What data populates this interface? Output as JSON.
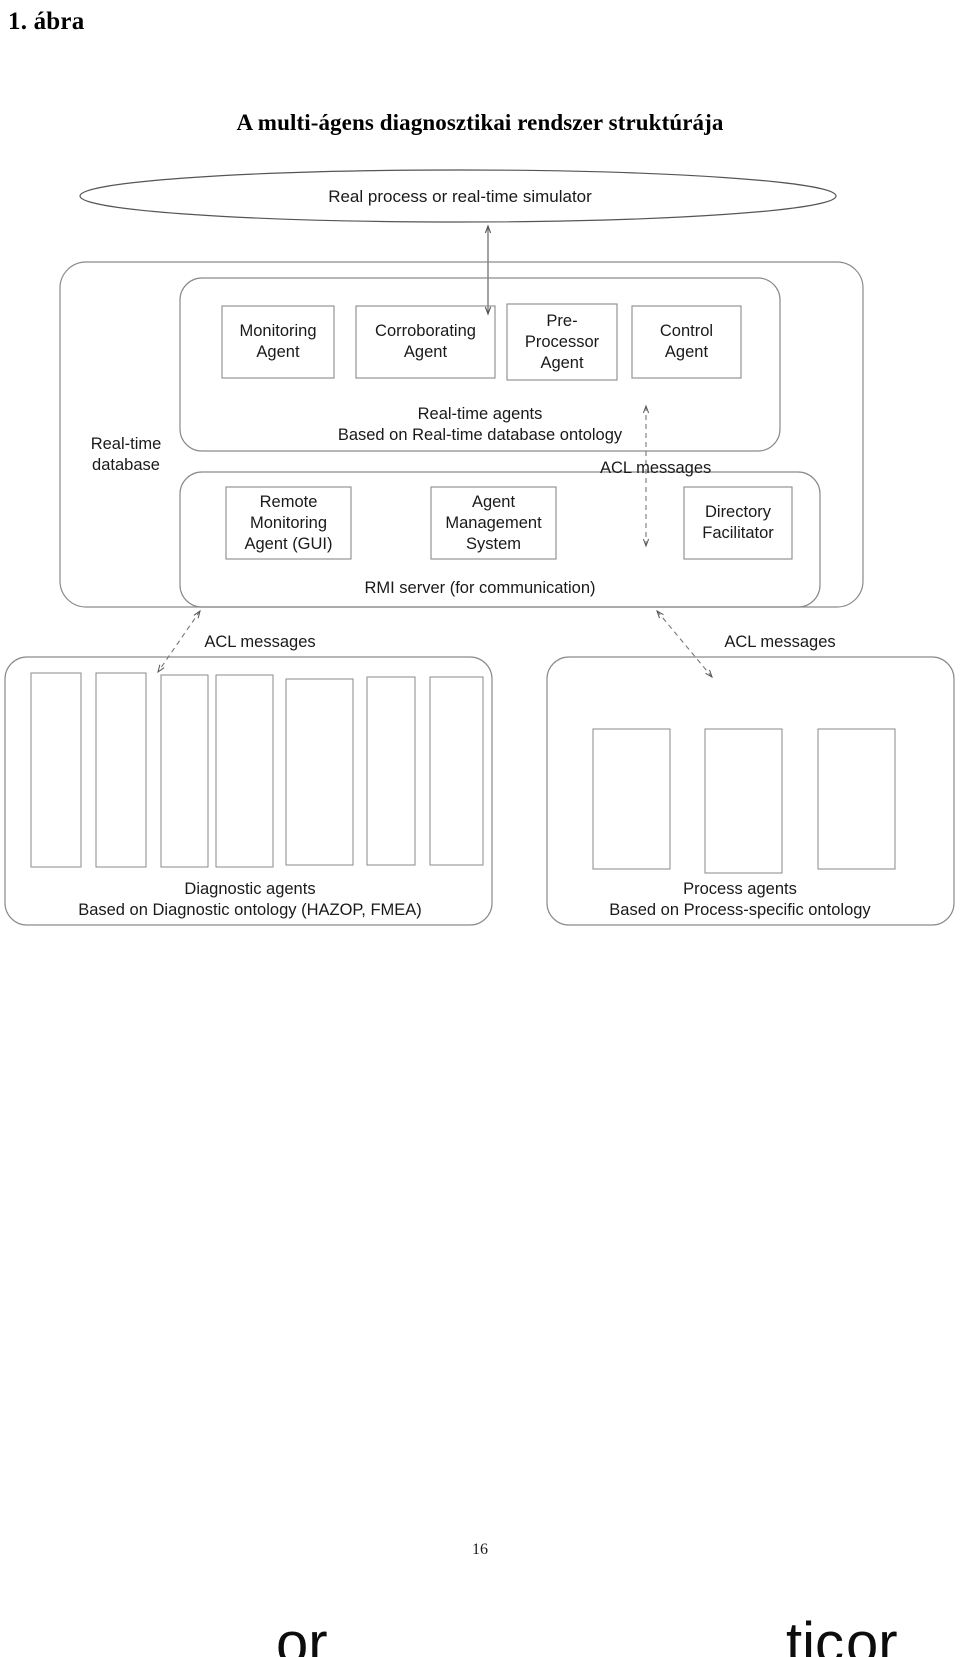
{
  "figure": {
    "label": "1. ábra",
    "title": "A multi-ágens diagnosztikai rendszer struktúrája"
  },
  "diagram": {
    "process_ellipse": {
      "label": "Real process or real-time simulator"
    },
    "realtime_database": {
      "label": "Real-time\ndatabase"
    },
    "realtime_agents_group": {
      "caption": "Real-time agents\nBased on Real-time database ontology",
      "agents": [
        {
          "label": "Monitoring\nAgent"
        },
        {
          "label": "Corroborating\nAgent"
        },
        {
          "label": "Pre-\nProcessor\nAgent"
        },
        {
          "label": "Control\nAgent"
        }
      ]
    },
    "platform_group": {
      "caption": "RMI server (for communication)",
      "agents": [
        {
          "label": "Remote\nMonitoring\nAgent (GUI)"
        },
        {
          "label": "Agent\nManagement\nSystem"
        },
        {
          "label": "Directory\nFacilitator"
        }
      ]
    },
    "diagnostic_group": {
      "caption": "Diagnostic agents\nBased on Diagnostic ontology (HAZOP, FMEA)",
      "agent_slot_count": 7
    },
    "process_group": {
      "caption": "Process agents\nBased on Process-specific ontology",
      "agent_slot_count": 3
    },
    "connections": {
      "acl_middle": "ACL messages",
      "acl_left": "ACL messages",
      "acl_right": "ACL messages"
    }
  },
  "page": {
    "number": "16"
  },
  "scan_artifacts": {
    "bottom_fragment_left": "or",
    "bottom_fragment_middle": "tic",
    "bottom_fragment_right": "or"
  },
  "colors": {
    "stroke": "#555555",
    "box_stroke": "#8a8a8a",
    "text": "#1a1a1a",
    "background": "#ffffff"
  }
}
